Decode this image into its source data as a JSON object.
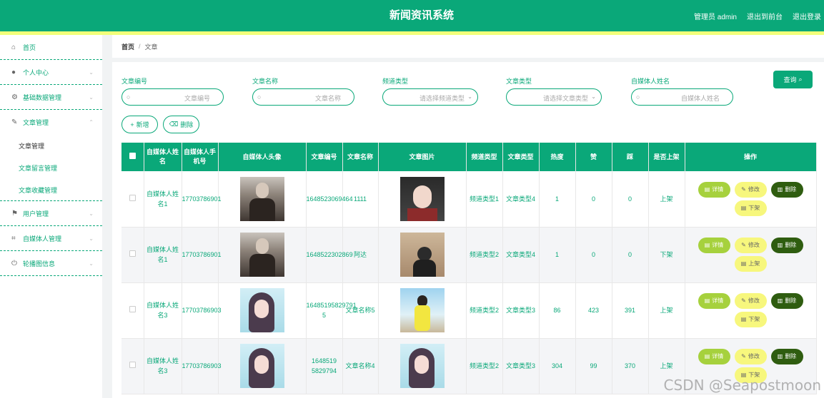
{
  "app": {
    "title": "新闻资讯系统",
    "admin_label": "管理员 admin",
    "back_front": "退出到前台",
    "logout": "退出登录"
  },
  "sidebar": {
    "items": [
      {
        "label": "首页",
        "icon": "home-icon"
      },
      {
        "label": "个人中心",
        "icon": "user-icon"
      },
      {
        "label": "基础数据管理",
        "icon": "settings-icon"
      },
      {
        "label": "文章管理",
        "icon": "edit-icon"
      },
      {
        "label": "用户管理",
        "icon": "flag-icon"
      },
      {
        "label": "自媒体人管理",
        "icon": "crop-icon"
      },
      {
        "label": "轮播图信息",
        "icon": "power-icon"
      }
    ],
    "sub_items": [
      "文章管理",
      "文章留言管理",
      "文章收藏管理"
    ]
  },
  "breadcrumb": {
    "home": "首页",
    "separator": "/",
    "current": "文章"
  },
  "filters": [
    {
      "label": "文章编号",
      "placeholder": "文章编号"
    },
    {
      "label": "文章名称",
      "placeholder": "文章名称"
    },
    {
      "label": "频道类型",
      "placeholder": "请选择频道类型"
    },
    {
      "label": "文章类型",
      "placeholder": "请选择文章类型"
    },
    {
      "label": "自媒体人姓名",
      "placeholder": "自媒体人姓名"
    }
  ],
  "buttons": {
    "query": "查询",
    "add": "新增",
    "delete": "删除"
  },
  "table": {
    "headers": [
      "自媒体人姓名",
      "自媒体人手机号",
      "自媒体人头像",
      "文章编号",
      "文章名称",
      "文章图片",
      "频道类型",
      "文章类型",
      "热度",
      "赞",
      "踩",
      "是否上架",
      "操作"
    ],
    "rows": [
      {
        "name": "自媒体人姓名1",
        "phone": "17703786901",
        "avatar": "man-photo",
        "article_no": "1648523069464",
        "article_name": "1111",
        "article_img": "girl-dark-photo",
        "channel": "频道类型1",
        "type": "文章类型4",
        "heat": "1",
        "likes": "0",
        "dislikes": "0",
        "status": "上架",
        "toggle": "下架"
      },
      {
        "name": "自媒体人姓名1",
        "phone": "17703786901",
        "avatar": "man-photo",
        "article_no": "1648522302869",
        "article_name": "阿达",
        "article_img": "back-photo",
        "channel": "频道类型2",
        "type": "文章类型4",
        "heat": "1",
        "likes": "0",
        "dislikes": "0",
        "status": "下架",
        "toggle": "上架"
      },
      {
        "name": "自媒体人姓名3",
        "phone": "17703786903",
        "avatar": "anime-girl-photo",
        "article_no": "16485195829791 5",
        "article_name": "文章名称5",
        "article_img": "yellow-girl-photo",
        "channel": "频道类型2",
        "type": "文章类型3",
        "heat": "86",
        "likes": "423",
        "dislikes": "391",
        "status": "上架",
        "toggle": "下架"
      },
      {
        "name": "自媒体人姓名3",
        "phone": "17703786903",
        "avatar": "anime-girl-photo",
        "article_no": "1648519 5829794",
        "article_name": "文章名称4",
        "article_img": "anime-girl-photo",
        "channel": "频道类型2",
        "type": "文章类型3",
        "heat": "304",
        "likes": "99",
        "dislikes": "370",
        "status": "上架",
        "toggle": "下架"
      }
    ],
    "ops": {
      "detail": "详情",
      "edit": "修改",
      "delete": "删除"
    }
  },
  "watermark": "CSDN @Seapostmoon",
  "colors": {
    "primary": "#0aa879",
    "accent_line": "#f2ff7a",
    "detail_btn": "#a6d13d",
    "edit_btn": "#f7f77d",
    "delete_btn": "#2f5d10"
  }
}
